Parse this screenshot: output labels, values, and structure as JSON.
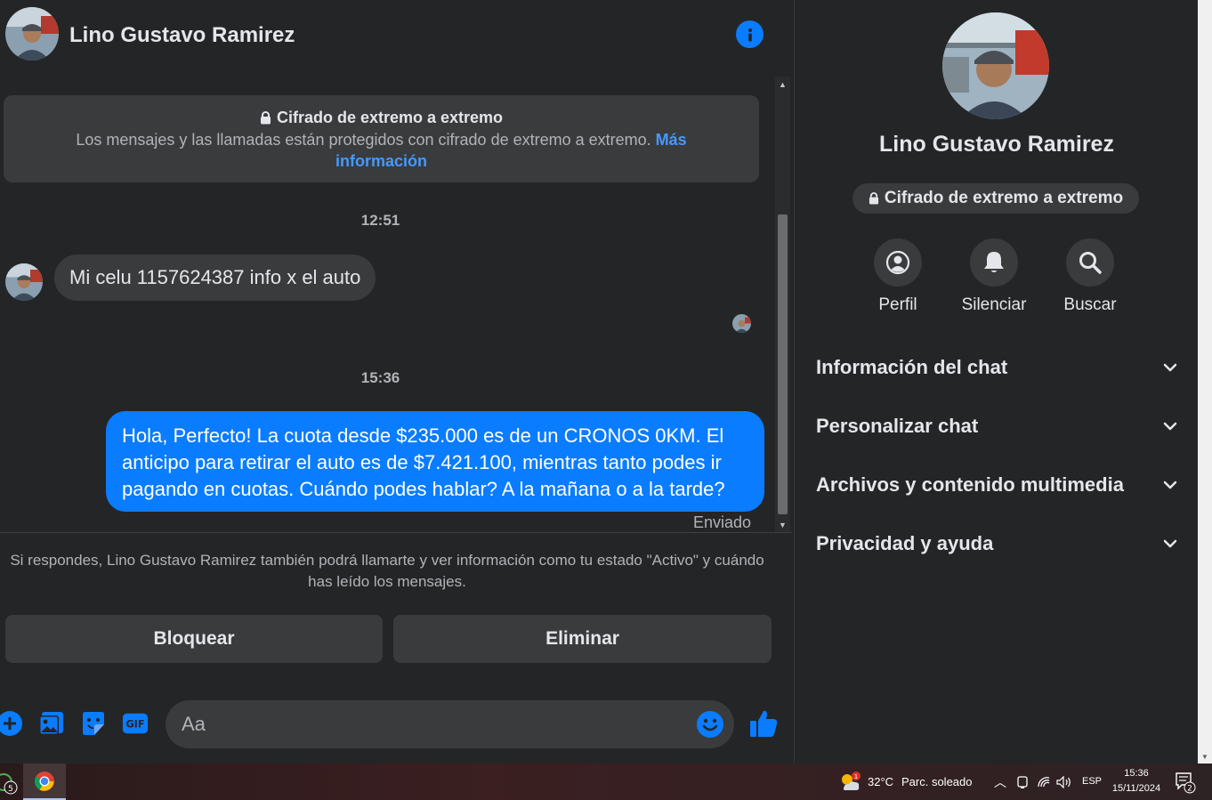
{
  "header": {
    "contact_name": "Lino Gustavo Ramirez"
  },
  "encryption_banner": {
    "title": "Cifrado de extremo a extremo",
    "text": "Los mensajes y las llamadas están protegidos con cifrado de extremo a extremo.",
    "link": "Más información"
  },
  "messages": [
    {
      "timestamp": "12:51",
      "direction": "incoming",
      "text": "Mi celu 1157624387 info x el auto"
    },
    {
      "timestamp": "15:36",
      "direction": "outgoing",
      "text": "Hola, Perfecto! La cuota desde $235.000 es de un CRONOS 0KM. El anticipo para retirar el auto es de $7.421.100, mientras tanto podes ir pagando en cuotas. Cuándo podes hablar? A la mañana o a la tarde?",
      "status": "Enviado"
    }
  ],
  "request_notice": "Si respondes, Lino Gustavo Ramirez también podrá llamarte y ver información como tu estado \"Activo\" y cuándo has leído los mensajes.",
  "actions": {
    "block": "Bloquear",
    "delete": "Eliminar"
  },
  "composer": {
    "placeholder": "Aa"
  },
  "info_panel": {
    "name": "Lino Gustavo Ramirez",
    "encryption_chip": "Cifrado de extremo a extremo",
    "quick_actions": [
      {
        "label": "Perfil",
        "icon": "profile-icon"
      },
      {
        "label": "Silenciar",
        "icon": "bell-icon"
      },
      {
        "label": "Buscar",
        "icon": "search-icon"
      }
    ],
    "sections": [
      "Información del chat",
      "Personalizar chat",
      "Archivos y contenido multimedia",
      "Privacidad y ayuda"
    ]
  },
  "taskbar": {
    "notification_badge": "5",
    "weather_temp": "32°C",
    "weather_desc": "Parc. soleado",
    "weather_badge": "1",
    "language": "ESP",
    "time": "15:36",
    "date": "15/11/2024",
    "notifications_count": "2"
  },
  "colors": {
    "background": "#242526",
    "surface": "#3a3b3c",
    "accent": "#0a7cff",
    "link": "#4599ff",
    "text_primary": "#e4e6eb",
    "text_secondary": "#b0b3b8"
  }
}
